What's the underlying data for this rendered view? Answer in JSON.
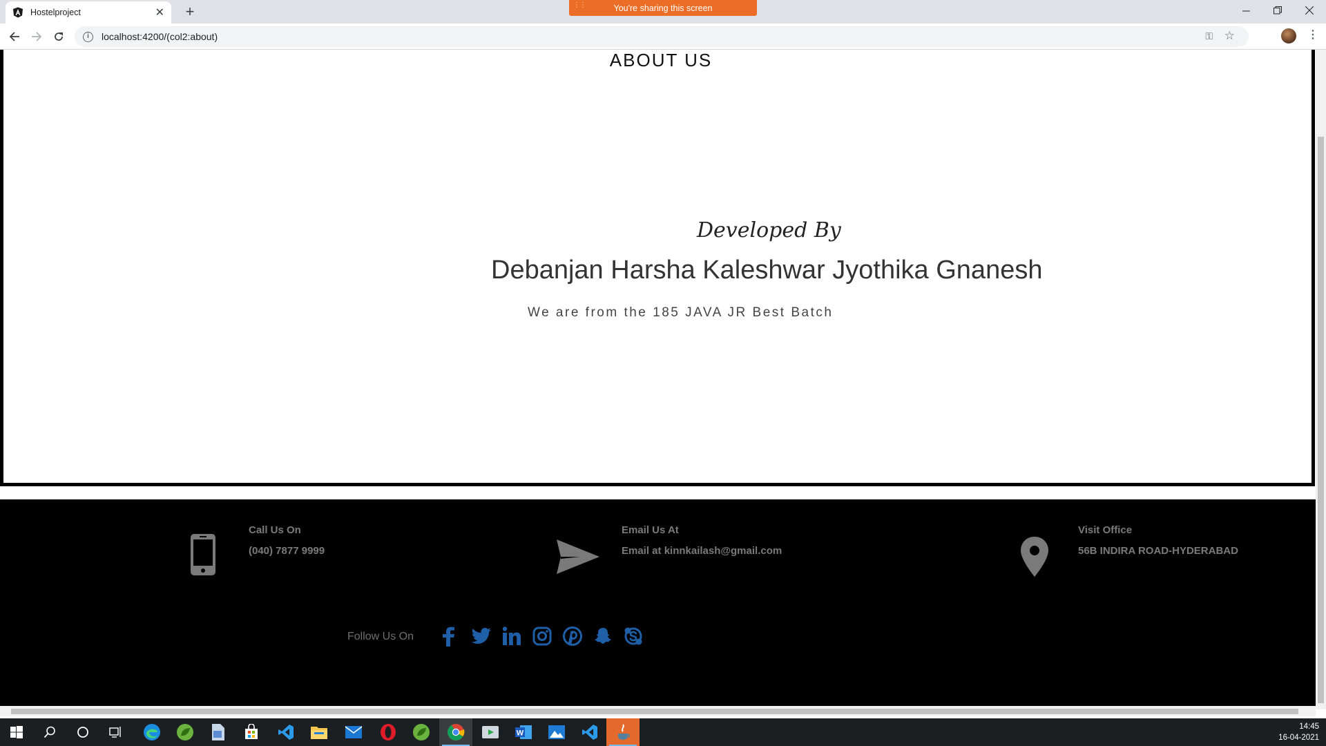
{
  "browser": {
    "tab_title": "Hostelproject",
    "sharing_banner": "You're sharing this screen",
    "url": "localhost:4200/(col2:about)",
    "new_tab_symbol": "+",
    "close_symbol": "✕"
  },
  "page": {
    "title": "ABOUT US",
    "developed_by_label": "Developed By",
    "developers": "Debanjan Harsha Kaleshwar Jyothika Gnanesh",
    "batch_text": "We are from the 185 JAVA JR Best Batch"
  },
  "footer": {
    "contacts": [
      {
        "icon": "phone-icon",
        "label": "Call Us On",
        "value": "(040) 7877 9999"
      },
      {
        "icon": "send-icon",
        "label": "Email Us At",
        "value": "Email at kinnkailash@gmail.com"
      },
      {
        "icon": "map-pin-icon",
        "label": "Visit Office",
        "value": "56B INDIRA ROAD-HYDERABAD"
      }
    ],
    "follow_label": "Follow Us On",
    "social_icons": [
      "facebook-icon",
      "twitter-icon",
      "linkedin-icon",
      "instagram-icon",
      "pinterest-icon",
      "snapchat-icon",
      "skype-icon"
    ],
    "icon_color": "#7a7a7a",
    "social_color": "#1f5fa8"
  },
  "taskbar": {
    "time": "14:45",
    "date": "16-04-2021"
  },
  "colors": {
    "share_banner": "#ec6d26",
    "footer_bg": "#000000",
    "taskbar_bg": "#1c1f22"
  }
}
